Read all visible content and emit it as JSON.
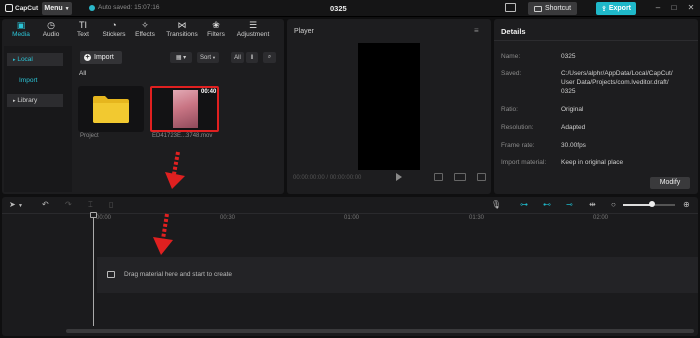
{
  "titlebar": {
    "app_name": "CapCut",
    "menu_label": "Menu",
    "auto_saved": "Auto saved: 15:07:16",
    "project_title": "0325",
    "shortcut_label": "Shortcut",
    "export_label": "Export"
  },
  "media_tabs": [
    {
      "label": "Media",
      "icon": "media-icon",
      "active": true
    },
    {
      "label": "Audio",
      "icon": "audio-icon"
    },
    {
      "label": "Text",
      "icon": "text-icon"
    },
    {
      "label": "Stickers",
      "icon": "stickers-icon"
    },
    {
      "label": "Effects",
      "icon": "effects-icon"
    },
    {
      "label": "Transitions",
      "icon": "transitions-icon"
    },
    {
      "label": "Filters",
      "icon": "filters-icon"
    },
    {
      "label": "Adjustment",
      "icon": "adjustment-icon"
    }
  ],
  "left_nav": {
    "local": "Local",
    "import": "Import",
    "library": "Library"
  },
  "media_toolbar": {
    "import_label": "Import",
    "sort_label": "Sort",
    "all_filter": "All"
  },
  "media": {
    "section_label": "All",
    "project_label": "Project",
    "video_duration": "00:40",
    "video_label": "ED41723E...3748.mov"
  },
  "player": {
    "title": "Player",
    "time": "00:00:00:00 / 00:00:00:00"
  },
  "details": {
    "title": "Details",
    "name_label": "Name:",
    "name_value": "0325",
    "saved_label": "Saved:",
    "saved_value": [
      "C:/Users/alphr/AppData/Local/CapCut/",
      "User Data/Projects/com.lveditor.draft/",
      "0325"
    ],
    "ratio_label": "Ratio:",
    "ratio_value": "Original",
    "resolution_label": "Resolution:",
    "resolution_value": "Adapted",
    "framerate_label": "Frame rate:",
    "framerate_value": "30.00fps",
    "import_material_label": "Import material:",
    "import_material_value": "Keep in original place",
    "modify_label": "Modify"
  },
  "timeline": {
    "ruler": [
      "00:00",
      "00:30",
      "01:00",
      "01:30",
      "02:00"
    ],
    "drop_hint": "Drag material here and start to create"
  },
  "colors": {
    "accent": "#1fb8c9",
    "arrow": "#e02020"
  }
}
